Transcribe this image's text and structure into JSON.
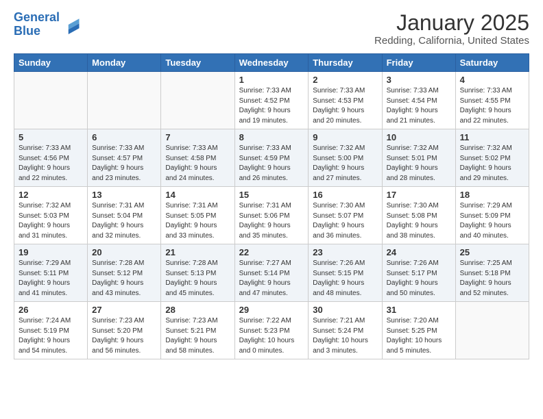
{
  "header": {
    "logo_line1": "General",
    "logo_line2": "Blue",
    "month": "January 2025",
    "location": "Redding, California, United States"
  },
  "weekdays": [
    "Sunday",
    "Monday",
    "Tuesday",
    "Wednesday",
    "Thursday",
    "Friday",
    "Saturday"
  ],
  "weeks": [
    [
      {
        "day": "",
        "info": ""
      },
      {
        "day": "",
        "info": ""
      },
      {
        "day": "",
        "info": ""
      },
      {
        "day": "1",
        "info": "Sunrise: 7:33 AM\nSunset: 4:52 PM\nDaylight: 9 hours\nand 19 minutes."
      },
      {
        "day": "2",
        "info": "Sunrise: 7:33 AM\nSunset: 4:53 PM\nDaylight: 9 hours\nand 20 minutes."
      },
      {
        "day": "3",
        "info": "Sunrise: 7:33 AM\nSunset: 4:54 PM\nDaylight: 9 hours\nand 21 minutes."
      },
      {
        "day": "4",
        "info": "Sunrise: 7:33 AM\nSunset: 4:55 PM\nDaylight: 9 hours\nand 22 minutes."
      }
    ],
    [
      {
        "day": "5",
        "info": "Sunrise: 7:33 AM\nSunset: 4:56 PM\nDaylight: 9 hours\nand 22 minutes."
      },
      {
        "day": "6",
        "info": "Sunrise: 7:33 AM\nSunset: 4:57 PM\nDaylight: 9 hours\nand 23 minutes."
      },
      {
        "day": "7",
        "info": "Sunrise: 7:33 AM\nSunset: 4:58 PM\nDaylight: 9 hours\nand 24 minutes."
      },
      {
        "day": "8",
        "info": "Sunrise: 7:33 AM\nSunset: 4:59 PM\nDaylight: 9 hours\nand 26 minutes."
      },
      {
        "day": "9",
        "info": "Sunrise: 7:32 AM\nSunset: 5:00 PM\nDaylight: 9 hours\nand 27 minutes."
      },
      {
        "day": "10",
        "info": "Sunrise: 7:32 AM\nSunset: 5:01 PM\nDaylight: 9 hours\nand 28 minutes."
      },
      {
        "day": "11",
        "info": "Sunrise: 7:32 AM\nSunset: 5:02 PM\nDaylight: 9 hours\nand 29 minutes."
      }
    ],
    [
      {
        "day": "12",
        "info": "Sunrise: 7:32 AM\nSunset: 5:03 PM\nDaylight: 9 hours\nand 31 minutes."
      },
      {
        "day": "13",
        "info": "Sunrise: 7:31 AM\nSunset: 5:04 PM\nDaylight: 9 hours\nand 32 minutes."
      },
      {
        "day": "14",
        "info": "Sunrise: 7:31 AM\nSunset: 5:05 PM\nDaylight: 9 hours\nand 33 minutes."
      },
      {
        "day": "15",
        "info": "Sunrise: 7:31 AM\nSunset: 5:06 PM\nDaylight: 9 hours\nand 35 minutes."
      },
      {
        "day": "16",
        "info": "Sunrise: 7:30 AM\nSunset: 5:07 PM\nDaylight: 9 hours\nand 36 minutes."
      },
      {
        "day": "17",
        "info": "Sunrise: 7:30 AM\nSunset: 5:08 PM\nDaylight: 9 hours\nand 38 minutes."
      },
      {
        "day": "18",
        "info": "Sunrise: 7:29 AM\nSunset: 5:09 PM\nDaylight: 9 hours\nand 40 minutes."
      }
    ],
    [
      {
        "day": "19",
        "info": "Sunrise: 7:29 AM\nSunset: 5:11 PM\nDaylight: 9 hours\nand 41 minutes."
      },
      {
        "day": "20",
        "info": "Sunrise: 7:28 AM\nSunset: 5:12 PM\nDaylight: 9 hours\nand 43 minutes."
      },
      {
        "day": "21",
        "info": "Sunrise: 7:28 AM\nSunset: 5:13 PM\nDaylight: 9 hours\nand 45 minutes."
      },
      {
        "day": "22",
        "info": "Sunrise: 7:27 AM\nSunset: 5:14 PM\nDaylight: 9 hours\nand 47 minutes."
      },
      {
        "day": "23",
        "info": "Sunrise: 7:26 AM\nSunset: 5:15 PM\nDaylight: 9 hours\nand 48 minutes."
      },
      {
        "day": "24",
        "info": "Sunrise: 7:26 AM\nSunset: 5:17 PM\nDaylight: 9 hours\nand 50 minutes."
      },
      {
        "day": "25",
        "info": "Sunrise: 7:25 AM\nSunset: 5:18 PM\nDaylight: 9 hours\nand 52 minutes."
      }
    ],
    [
      {
        "day": "26",
        "info": "Sunrise: 7:24 AM\nSunset: 5:19 PM\nDaylight: 9 hours\nand 54 minutes."
      },
      {
        "day": "27",
        "info": "Sunrise: 7:23 AM\nSunset: 5:20 PM\nDaylight: 9 hours\nand 56 minutes."
      },
      {
        "day": "28",
        "info": "Sunrise: 7:23 AM\nSunset: 5:21 PM\nDaylight: 9 hours\nand 58 minutes."
      },
      {
        "day": "29",
        "info": "Sunrise: 7:22 AM\nSunset: 5:23 PM\nDaylight: 10 hours\nand 0 minutes."
      },
      {
        "day": "30",
        "info": "Sunrise: 7:21 AM\nSunset: 5:24 PM\nDaylight: 10 hours\nand 3 minutes."
      },
      {
        "day": "31",
        "info": "Sunrise: 7:20 AM\nSunset: 5:25 PM\nDaylight: 10 hours\nand 5 minutes."
      },
      {
        "day": "",
        "info": ""
      }
    ]
  ]
}
